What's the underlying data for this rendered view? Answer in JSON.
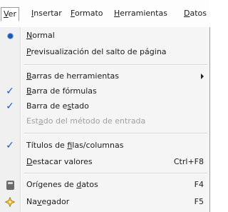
{
  "menubar": {
    "items": [
      {
        "label": "Ver",
        "u": "V",
        "rest": "er",
        "active": true
      },
      {
        "label": "Insertar",
        "u": "I",
        "rest": "nsertar"
      },
      {
        "label": "Formato",
        "u": "F",
        "rest": "ormato"
      },
      {
        "label": "Herramientas",
        "u": "H",
        "rest": "erramientas"
      },
      {
        "label": "Datos",
        "u": "D",
        "rest": "atos"
      }
    ]
  },
  "menu": {
    "items": [
      {
        "pre": "",
        "u": "N",
        "post": "ormal",
        "state": "radio"
      },
      {
        "pre": "",
        "u": "P",
        "post": "revisualización del salto de página",
        "state": "none"
      },
      {
        "pre": "",
        "u": "B",
        "post": "arras de herramientas",
        "state": "submenu"
      },
      {
        "pre": "",
        "u": "B",
        "post": "arra de fórmulas",
        "state": "checked"
      },
      {
        "pre": "Barra de e",
        "u": "s",
        "post": "tado",
        "state": "checked"
      },
      {
        "pre": "Est",
        "u": "a",
        "post": "do del método de entrada",
        "state": "disabled"
      },
      {
        "pre": "Títulos de ",
        "u": "f",
        "post": "ilas/columnas",
        "state": "checked"
      },
      {
        "pre": "",
        "u": "D",
        "post": "estacar valores",
        "shortcut": "Ctrl+F8",
        "state": "none"
      },
      {
        "pre": "Orígenes de ",
        "u": "d",
        "post": "atos",
        "shortcut": "F4",
        "icon": "database-icon"
      },
      {
        "pre": "Na",
        "u": "v",
        "post": "egador",
        "shortcut": "F5",
        "icon": "navigator-icon"
      }
    ]
  },
  "colors": {
    "check": "#1e5bb8",
    "radio": "#1f5ab2",
    "disabled": "#a0a0a0"
  }
}
